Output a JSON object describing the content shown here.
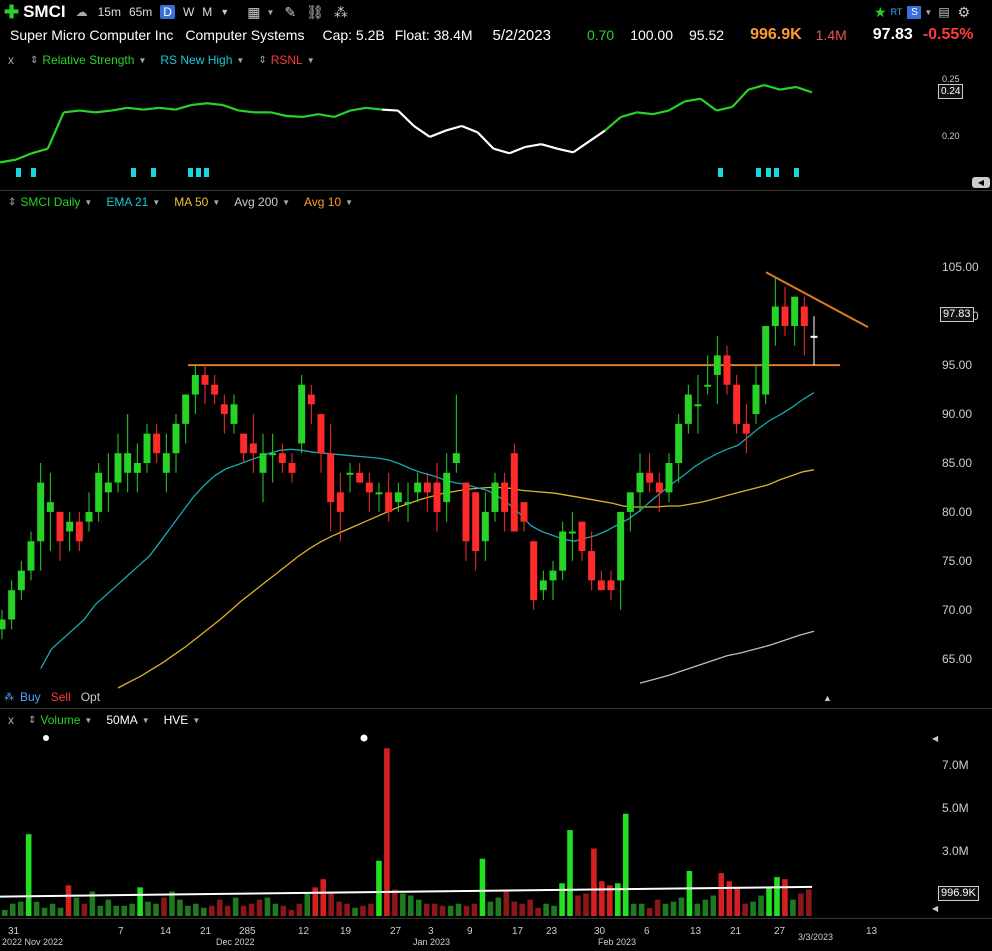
{
  "header": {
    "ticker": "SMCI",
    "timeframes": [
      "15m",
      "65m",
      "D",
      "W",
      "M"
    ],
    "active_timeframe": "D",
    "company": "Super Micro Computer Inc",
    "sector": "Computer Systems",
    "cap": "Cap: 5.2B",
    "float": "Float: 38.4M",
    "date": "5/2/2023",
    "change": "0.70",
    "open": "100.00",
    "low": "95.52",
    "volume": "996.9K",
    "avg_volume": "1.4M",
    "price": "97.83",
    "change_pct": "-0.55%",
    "rt_label": "RT",
    "colors": {
      "up": "#27d327",
      "down": "#ff2b2b",
      "vol_orange": "#ff9933",
      "vol_red": "#e03a3a"
    }
  },
  "rs_panel": {
    "labels": [
      "Relative Strength",
      "RS New High",
      "RSNL"
    ],
    "close_label": "x",
    "scale_labels": [
      "0.25",
      "0.20"
    ],
    "badge": "0.24"
  },
  "price_panel": {
    "labels": [
      "SMCI Daily",
      "EMA 21",
      "MA 50",
      "Avg 200",
      "Avg 10"
    ],
    "y_labels": [
      "105.00",
      "100.00",
      "95.00",
      "90.00",
      "85.00",
      "80.00",
      "75.00",
      "70.00",
      "65.00"
    ],
    "badge": "97.83",
    "trade": [
      "Buy",
      "Sell",
      "Opt"
    ]
  },
  "volume_panel": {
    "labels": [
      "Volume",
      "50MA",
      "HVE"
    ],
    "close_label": "x",
    "y_labels": [
      "7.0M",
      "5.0M",
      "3.0M"
    ],
    "badge": "996.9K"
  },
  "x_axis": {
    "labels": [
      "31",
      "2022 Nov 2022",
      "7",
      "14",
      "21",
      "28",
      "Dec 2022",
      "5",
      "12",
      "19",
      "27",
      "Jan 2023",
      "3",
      "9",
      "17",
      "23",
      "30",
      "Feb 2023",
      "6",
      "13",
      "21",
      "27",
      "3/3/2023",
      "13"
    ]
  },
  "chart_data": {
    "type": "candlestick",
    "ylim": [
      62,
      108
    ],
    "candles": [
      [
        68,
        70,
        67,
        69
      ],
      [
        69,
        73,
        68,
        72
      ],
      [
        72,
        75,
        71,
        74
      ],
      [
        74,
        78,
        73,
        77
      ],
      [
        77,
        85,
        74,
        83
      ],
      [
        80,
        84,
        76,
        81
      ],
      [
        80,
        80,
        75,
        77
      ],
      [
        78,
        80,
        76,
        79
      ],
      [
        79,
        80,
        76,
        77
      ],
      [
        79,
        82,
        78,
        80
      ],
      [
        80,
        85,
        79,
        84
      ],
      [
        82,
        86,
        80,
        83
      ],
      [
        83,
        88,
        82,
        86
      ],
      [
        84,
        90,
        82,
        86
      ],
      [
        84,
        87,
        82,
        85
      ],
      [
        85,
        89,
        84,
        88
      ],
      [
        88,
        89,
        85,
        86
      ],
      [
        84,
        88,
        82,
        86
      ],
      [
        86,
        90,
        84,
        89
      ],
      [
        89,
        92,
        87,
        92
      ],
      [
        92,
        95,
        90,
        94
      ],
      [
        94,
        95,
        91,
        93
      ],
      [
        93,
        94,
        91,
        92
      ],
      [
        91,
        92,
        88,
        90
      ],
      [
        89,
        92,
        88,
        91
      ],
      [
        88,
        88,
        85,
        86
      ],
      [
        87,
        90,
        84,
        86
      ],
      [
        84,
        88,
        81,
        86
      ],
      [
        86,
        88,
        83,
        86
      ],
      [
        86,
        87,
        84,
        85
      ],
      [
        85,
        86,
        83,
        84
      ],
      [
        87,
        94,
        86,
        93
      ],
      [
        92,
        93,
        89,
        91
      ],
      [
        90,
        90,
        84,
        86
      ],
      [
        86,
        89,
        78,
        81
      ],
      [
        82,
        84,
        77,
        80
      ],
      [
        84,
        85,
        82,
        84
      ],
      [
        84,
        85,
        83,
        83
      ],
      [
        83,
        84,
        80,
        82
      ],
      [
        82,
        83,
        80,
        82
      ],
      [
        82,
        84,
        79,
        80
      ],
      [
        81,
        83,
        80,
        82
      ],
      [
        81,
        83,
        79,
        81
      ],
      [
        82,
        84,
        81,
        83
      ],
      [
        83,
        84,
        80,
        82
      ],
      [
        83,
        85,
        78,
        80
      ],
      [
        81,
        86,
        79,
        84
      ],
      [
        85,
        92,
        84,
        86
      ],
      [
        83,
        83,
        75,
        77
      ],
      [
        82,
        82,
        74,
        76
      ],
      [
        77,
        82,
        75,
        80
      ],
      [
        80,
        84,
        79,
        83
      ],
      [
        83,
        84,
        78,
        80
      ],
      [
        86,
        87,
        80,
        78
      ],
      [
        81,
        81,
        78,
        79
      ],
      [
        77,
        77,
        70,
        71
      ],
      [
        72,
        74,
        71,
        73
      ],
      [
        73,
        75,
        71,
        74
      ],
      [
        74,
        79,
        73,
        78
      ],
      [
        78,
        80,
        75,
        78
      ],
      [
        79,
        79,
        75,
        76
      ],
      [
        76,
        78,
        72,
        73
      ],
      [
        73,
        74,
        72,
        72
      ],
      [
        73,
        74,
        71,
        72
      ],
      [
        73,
        80,
        70,
        80
      ],
      [
        80,
        82,
        78,
        82
      ],
      [
        82,
        86,
        80,
        84
      ],
      [
        84,
        86,
        82,
        83
      ],
      [
        83,
        84,
        80,
        82
      ],
      [
        82,
        86,
        81,
        85
      ],
      [
        85,
        90,
        83,
        89
      ],
      [
        89,
        93,
        88,
        92
      ],
      [
        91,
        94,
        88,
        91
      ],
      [
        93,
        96,
        92,
        93
      ],
      [
        94,
        98,
        91,
        96
      ],
      [
        96,
        97,
        92,
        93
      ],
      [
        93,
        94,
        88,
        89
      ],
      [
        89,
        91,
        86,
        88
      ],
      [
        90,
        95,
        89,
        93
      ],
      [
        92,
        99,
        91,
        99
      ],
      [
        99,
        104,
        97,
        101
      ],
      [
        101,
        103,
        98,
        99
      ],
      [
        99,
        102,
        97,
        102
      ],
      [
        101,
        102,
        96,
        99
      ],
      [
        98,
        100,
        95,
        97.83
      ]
    ],
    "ema21": [
      64,
      66,
      67,
      68,
      69,
      70.5,
      71.5,
      72.5,
      73.5,
      74.5,
      75.5,
      77,
      78.5,
      80,
      81.5,
      82.7,
      83.7,
      84.4,
      84.8,
      85.2,
      85.6,
      86.0,
      86.3,
      86.4,
      86.3,
      86.1,
      86.0,
      85.9,
      85.8,
      85.7,
      85.6,
      85.5,
      85.3,
      84.9,
      84.4,
      84.0,
      83.7,
      83.3,
      83.0,
      82.8,
      82.5,
      82.2,
      81.6,
      80.8,
      79.8,
      78.6,
      78.0,
      77.6,
      77.2,
      77.0,
      77.3,
      77.6,
      78.1,
      78.7,
      79.3,
      80.1,
      81.1,
      82.0,
      82.9,
      83.7,
      84.6,
      85.3,
      85.9,
      86.4,
      86.8,
      87.7,
      88.6,
      89.4,
      90.0,
      90.7,
      91.5,
      92.2
    ],
    "ma50": [
      62,
      62.6,
      63.2,
      63.9,
      64.6,
      65.4,
      66.2,
      67.1,
      68.0,
      68.9,
      69.9,
      70.9,
      71.8,
      72.7,
      73.6,
      74.5,
      75.4,
      76.2,
      76.9,
      77.5,
      78.0,
      78.5,
      79.0,
      79.5,
      80.0,
      80.5,
      80.9,
      81.3,
      81.6,
      81.9,
      82.1,
      82.3,
      82.4,
      82.5,
      82.5,
      82.4,
      82.2,
      82.1,
      82.0,
      81.9,
      81.7,
      81.5,
      81.3,
      81.1,
      80.9,
      80.6,
      80.5,
      80.5,
      80.5,
      80.6,
      80.6,
      80.8,
      81.0,
      81.3,
      81.6,
      81.9,
      82.2,
      82.5,
      82.8,
      83.3,
      83.7,
      84.1,
      84.3
    ],
    "ma200": [
      62.5,
      62.9,
      63.3,
      63.8,
      64.3,
      64.8,
      65.3,
      65.6,
      66.0,
      66.4,
      66.9,
      67.4,
      67.8
    ],
    "avg10_trend": [
      104.5,
      99.3
    ],
    "resistance": 95.0,
    "rs": [
      0.175,
      0.178,
      0.185,
      0.19,
      0.23,
      0.232,
      0.23,
      0.232,
      0.235,
      0.233,
      0.235,
      0.233,
      0.238,
      0.24,
      0.238,
      0.232,
      0.23,
      0.23,
      0.226,
      0.225,
      0.228,
      0.225,
      0.232,
      0.235,
      0.233,
      0.232,
      0.215,
      0.203,
      0.21,
      0.215,
      0.208,
      0.19,
      0.185,
      0.192,
      0.195,
      0.19,
      0.186,
      0.198,
      0.21,
      0.225,
      0.23,
      0.228,
      0.232,
      0.242,
      0.245,
      0.232,
      0.236,
      0.255,
      0.26,
      0.255,
      0.258,
      0.252
    ],
    "volume_m": [
      0.3,
      0.6,
      0.7,
      4.0,
      0.7,
      0.4,
      0.6,
      0.4,
      1.5,
      0.9,
      0.6,
      1.2,
      0.5,
      0.8,
      0.5,
      0.5,
      0.6,
      1.4,
      0.7,
      0.6,
      0.9,
      1.2,
      0.8,
      0.5,
      0.6,
      0.4,
      0.5,
      0.8,
      0.5,
      0.9,
      0.5,
      0.6,
      0.8,
      0.9,
      0.6,
      0.5,
      0.3,
      0.6,
      1.1,
      1.4,
      1.8,
      1.1,
      0.7,
      0.6,
      0.4,
      0.5,
      0.6,
      2.7,
      8.2,
      1.3,
      1.1,
      1.0,
      0.8,
      0.6,
      0.6,
      0.5,
      0.5,
      0.6,
      0.5,
      0.6,
      2.8,
      0.7,
      0.9,
      1.3,
      0.7,
      0.6,
      0.8,
      0.4,
      0.6,
      0.5,
      1.6,
      4.2,
      1.0,
      1.1,
      3.3,
      1.7,
      1.5,
      1.6,
      5.0,
      0.6,
      0.6,
      0.4,
      0.8,
      0.6,
      0.7,
      0.9,
      2.2,
      0.6,
      0.8,
      1.0,
      2.1,
      1.7,
      1.4,
      0.6,
      0.7,
      1.0,
      1.4,
      1.9,
      1.8,
      0.8,
      1.1,
      1.3
    ],
    "vol_ma": 0.95
  }
}
